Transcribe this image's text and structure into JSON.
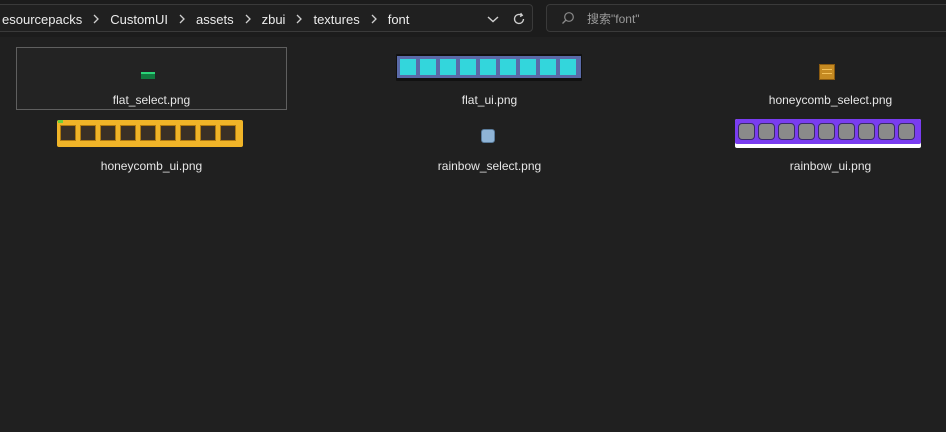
{
  "address_bar": {
    "breadcrumbs": [
      "esourcepacks",
      "CustomUI",
      "assets",
      "zbui",
      "textures",
      "font"
    ],
    "dropdown_icon": "chevron-down-icon",
    "refresh_icon": "refresh-icon"
  },
  "search": {
    "placeholder": "搜索\"font\"",
    "value": "",
    "icon": "search-icon"
  },
  "files": [
    {
      "name": "flat_select.png",
      "selected": true
    },
    {
      "name": "flat_ui.png",
      "selected": false
    },
    {
      "name": "honeycomb_select.png",
      "selected": false
    },
    {
      "name": "honeycomb_ui.png",
      "selected": false
    },
    {
      "name": "rainbow_select.png",
      "selected": false
    },
    {
      "name": "rainbow_ui.png",
      "selected": false
    }
  ],
  "colors": {
    "background": "#202020",
    "flat_slot": "#33d6dc",
    "flat_frame": "#5a6aa8",
    "honeycomb_frame": "#f0b428",
    "rainbow_frame": "#7a3df0",
    "rainbow_slot": "#8a8a8a",
    "rainbow_select": "#8fb4d6",
    "select_green": "#1fa35a"
  }
}
